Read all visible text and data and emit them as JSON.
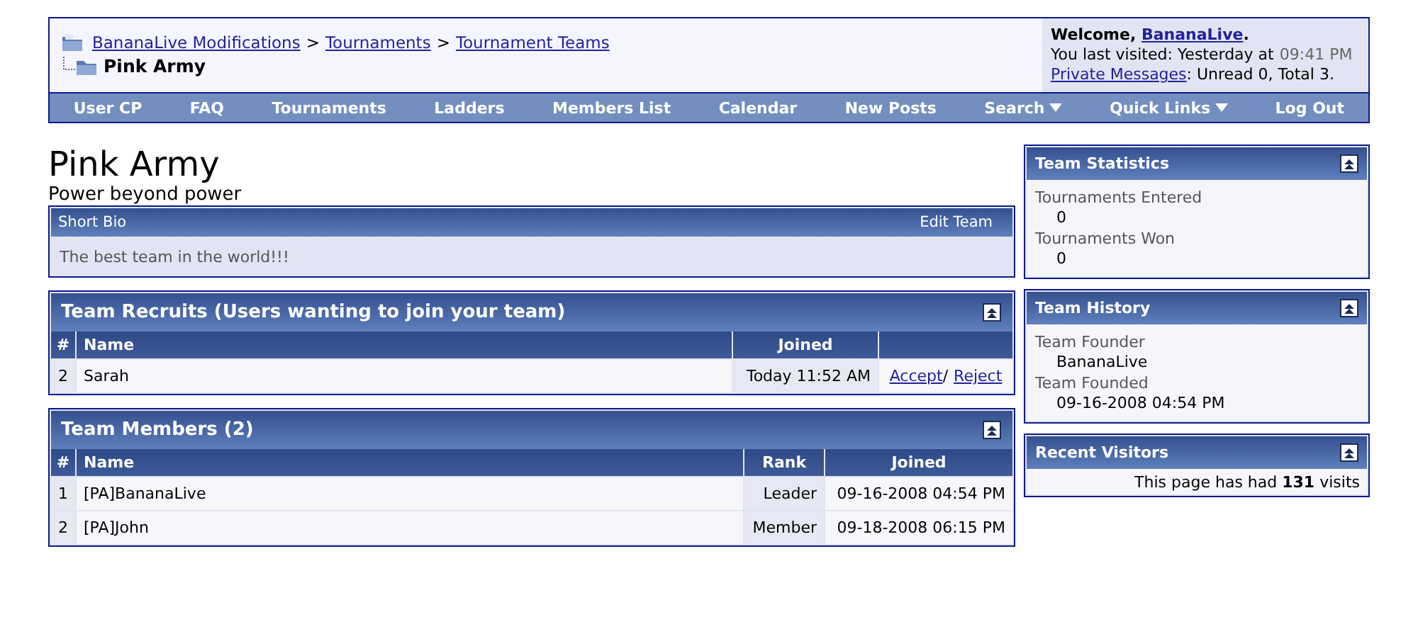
{
  "breadcrumb": {
    "links": [
      "BananaLive Modifications",
      "Tournaments",
      "Tournament Teams"
    ],
    "separator": ">",
    "current": "Pink Army"
  },
  "welcome": {
    "prefix": "Welcome,",
    "user": "BananaLive",
    "suffix": ".",
    "last_visited_label": "You last visited: Yesterday at",
    "last_visited_time": "09:41 PM",
    "pm_link": "Private Messages",
    "pm_status": ": Unread 0, Total 3."
  },
  "navbar": [
    {
      "label": "User CP",
      "has_menu": false
    },
    {
      "label": "FAQ",
      "has_menu": false
    },
    {
      "label": "Tournaments",
      "has_menu": false
    },
    {
      "label": "Ladders",
      "has_menu": false
    },
    {
      "label": "Members List",
      "has_menu": false
    },
    {
      "label": "Calendar",
      "has_menu": false
    },
    {
      "label": "New Posts",
      "has_menu": false
    },
    {
      "label": "Search",
      "has_menu": true
    },
    {
      "label": "Quick Links",
      "has_menu": true
    },
    {
      "label": "Log Out",
      "has_menu": false
    }
  ],
  "team": {
    "name": "Pink Army",
    "motto": "Power beyond power"
  },
  "bio": {
    "title": "Short Bio",
    "edit_link": "Edit Team",
    "text": "The best team in the world!!!"
  },
  "recruits": {
    "title": "Team Recruits (Users wanting to join your team)",
    "columns": [
      "#",
      "Name",
      "Joined",
      ""
    ],
    "separator": "/",
    "rows": [
      {
        "number": "2",
        "name": "Sarah",
        "joined": "Today 11:52 AM",
        "actions": [
          "Accept",
          "Reject"
        ]
      }
    ]
  },
  "members": {
    "title": "Team Members (2)",
    "columns": [
      "#",
      "Name",
      "Rank",
      "Joined"
    ],
    "rows": [
      {
        "number": "1",
        "name": "[PA]BananaLive",
        "rank": "Leader",
        "joined": "09-16-2008 04:54 PM"
      },
      {
        "number": "2",
        "name": "[PA]John",
        "rank": "Member",
        "joined": "09-18-2008 06:15 PM"
      }
    ]
  },
  "sidebar": [
    {
      "title": "Team Statistics",
      "kind": "fields",
      "fields": [
        {
          "label": "Tournaments Entered",
          "value": "0"
        },
        {
          "label": "Tournaments Won",
          "value": "0"
        }
      ]
    },
    {
      "title": "Team History",
      "kind": "fields",
      "fields": [
        {
          "label": "Team Founder",
          "value": "BananaLive"
        },
        {
          "label": "Team Founded",
          "value": "09-16-2008 04:54 PM"
        }
      ]
    },
    {
      "title": "Recent Visitors",
      "kind": "text",
      "text": "This page has had **131** visits"
    }
  ]
}
